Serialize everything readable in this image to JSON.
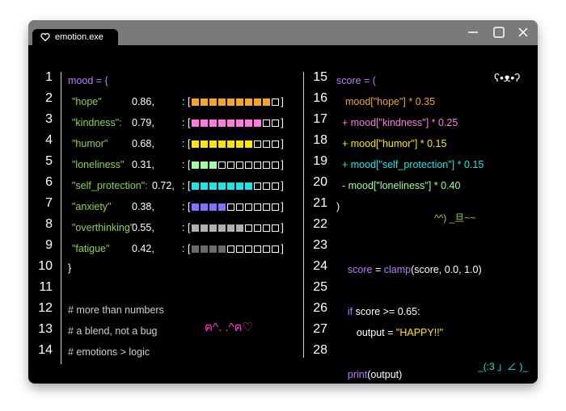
{
  "window": {
    "title": "emotion.exe"
  },
  "left_line_numbers": [
    "1",
    "2",
    "3",
    "4",
    "5",
    "6",
    "7",
    "8",
    "9",
    "10",
    "11",
    "12",
    "13",
    "14"
  ],
  "right_line_numbers": [
    "15",
    "16",
    "17",
    "18",
    "19",
    "20",
    "21",
    "22",
    "23",
    "24",
    "25",
    "26",
    "27",
    "28"
  ],
  "mood": {
    "open": "mood = {",
    "close": "}",
    "entries": [
      {
        "key": "\"hope\"",
        "value": "0.86,",
        "level": 0.9,
        "color": "#f5a623"
      },
      {
        "key": "\"kindness\":",
        "value": "0.79,",
        "level": 0.8,
        "color": "#ff7be0"
      },
      {
        "key": "\"humor\"",
        "value": "0.68,",
        "level": 0.7,
        "color": "#ffe600"
      },
      {
        "key": "\"loneliness\"",
        "value": "0.31,",
        "level": 0.3,
        "color": "#9dff9d"
      },
      {
        "key": "\"self_protection\":",
        "value": "0.72,",
        "level": 0.7,
        "color": "#19e6e6"
      },
      {
        "key": "\"anxiety\"",
        "value": "0.38,",
        "level": 0.4,
        "color": "#8b6cff"
      },
      {
        "key": "\"overthinking\"",
        "value": "0.55,",
        "level": 0.6,
        "color": "#b0b0b0"
      },
      {
        "key": "\"fatigue\"",
        "value": "0.42,",
        "level": 0.4,
        "color": "#6a6a6a"
      }
    ],
    "bar_prefix": ": [",
    "bar_suffix": "]"
  },
  "comments": [
    "# more than numbers",
    "# a blend, not a bug",
    "# emotions > logic"
  ],
  "kaomoji_left": "ฅ^. .^ฅ♡",
  "kaomoji_top_right": "ʕ•ᴥ•ʔ",
  "kaomoji_mid": "^^) _旦~~",
  "kaomoji_bottom": "_(:3 」∠ )_",
  "score_code": {
    "l15": "score = (",
    "l16a": "mood[\"hope\"] * 0.35",
    "l17": "+ mood[\"kindness\"] * 0.25",
    "l18": "+ mood[\"humor\"] * 0.15",
    "l19": "+ mood[\"self_protection\"] * 0.15",
    "l20": "- mood[\"loneliness\"] * 0.40",
    "l21": ")",
    "l23_var": "score",
    "l23_eq": " = ",
    "l23_fn": "clamp",
    "l23_args": "(score, 0.0, 1.0)",
    "l25_kw": "if",
    "l25_rest": " score >= 0.65:",
    "l26_lhs": "output = ",
    "l26_str": "\"HAPPY!!\"",
    "l28_fn": "print",
    "l28_args": "(output)"
  }
}
